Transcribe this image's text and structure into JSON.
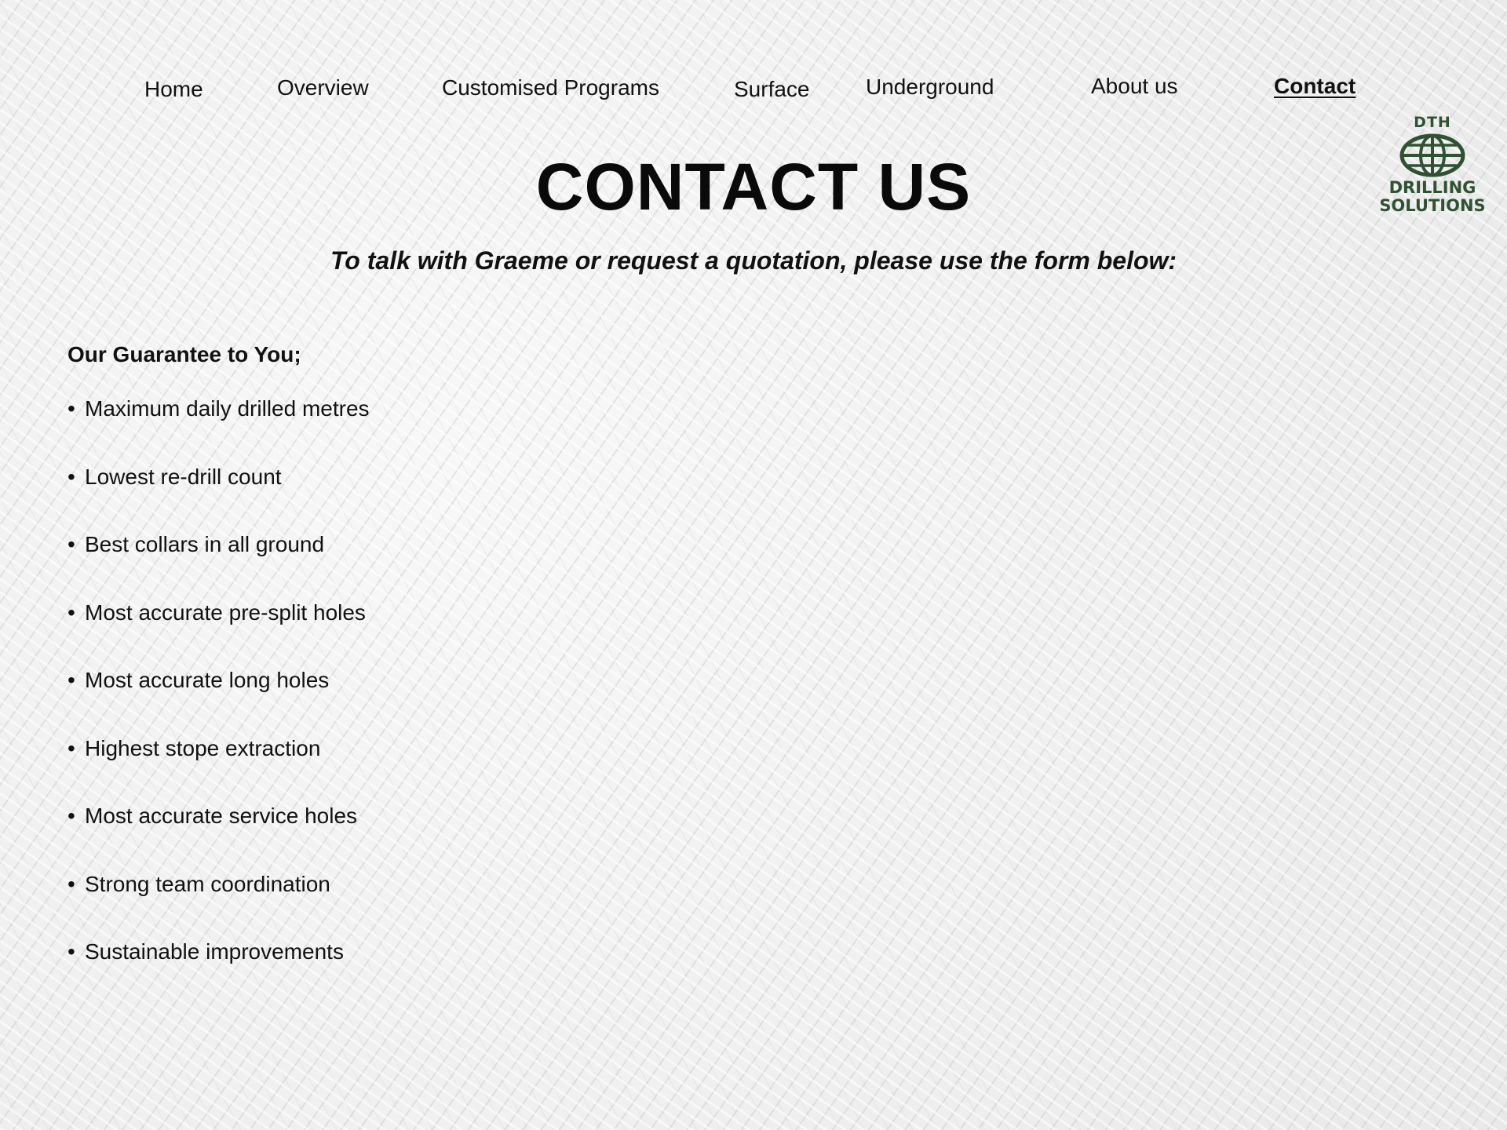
{
  "nav": {
    "items": [
      {
        "label": "Home",
        "active": false
      },
      {
        "label": "Overview",
        "active": false
      },
      {
        "label": "Customised Programs",
        "active": false
      },
      {
        "label": "Surface",
        "active": false
      },
      {
        "label": "Underground",
        "active": false
      },
      {
        "label": "About us",
        "active": false
      },
      {
        "label": "Contact",
        "active": true
      }
    ]
  },
  "logo": {
    "top_text": "DTH",
    "bottom_line1": "DRILLING",
    "bottom_line2": "SOLUTIONS",
    "icon": "globe-icon",
    "color": "#2f5233"
  },
  "page": {
    "title": "CONTACT US",
    "subtitle": "To talk with Graeme or request a quotation, please use the form below:"
  },
  "guarantee": {
    "heading": "Our Guarantee to You;",
    "bullet": "•",
    "items": [
      "Maximum daily drilled metres",
      "Lowest re-drill count",
      "Best collars in all ground",
      "Most accurate pre-split holes",
      "Most accurate long holes",
      "Highest stope extraction",
      "Most accurate service holes",
      "Strong team coordination",
      "Sustainable improvements"
    ]
  }
}
